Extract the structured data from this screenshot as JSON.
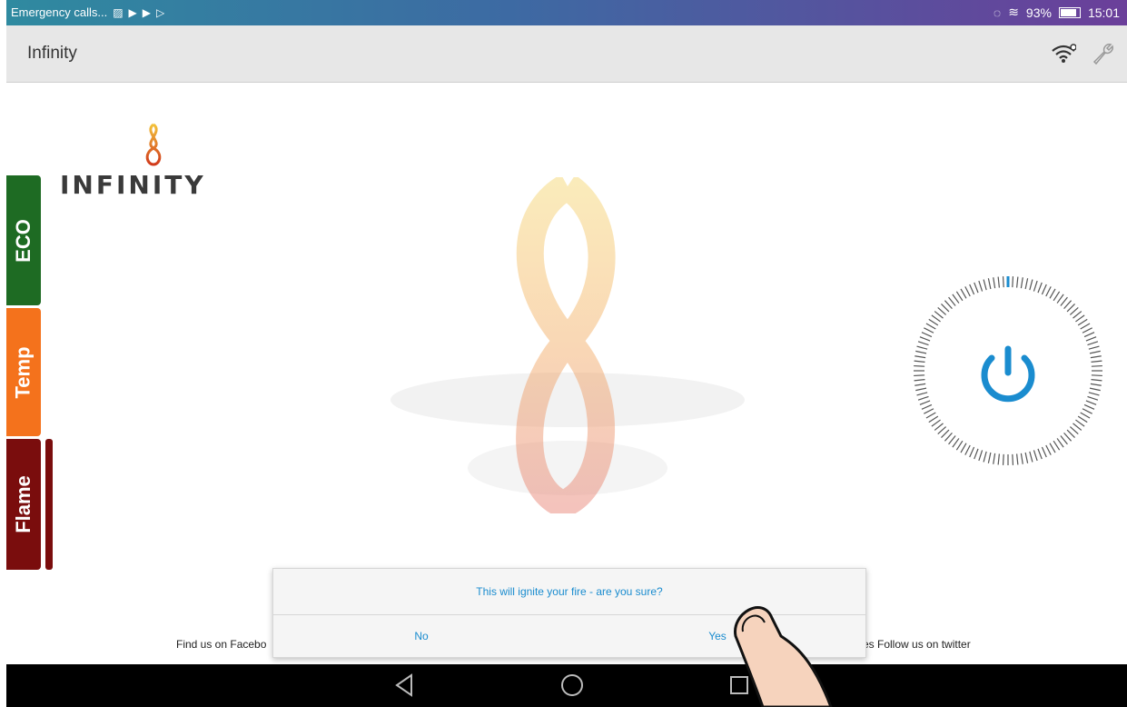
{
  "status_bar": {
    "left_text": "Emergency calls...",
    "notif_icons": [
      "image-icon",
      "play-icon",
      "play-icon",
      "play-icon"
    ],
    "battery_percent": "93%",
    "time": "15:01"
  },
  "app_bar": {
    "title": "Infinity",
    "icons": [
      "wifi-icon",
      "wrench-icon"
    ]
  },
  "brand": {
    "logo_text": "INFINITY"
  },
  "side_tabs": [
    {
      "label": "ECO",
      "color": "#1e6b23"
    },
    {
      "label": "Temp",
      "color": "#f4721c"
    },
    {
      "label": "Flame",
      "color": "#7a0d0d"
    }
  ],
  "power_dial": {
    "icon": "power-icon",
    "accent_color": "#1a8ccf"
  },
  "footer": {
    "left_text": "Find us on Facebo",
    "right_text": "es Follow us on twitter"
  },
  "dialog": {
    "message": "This will ignite your fire - are you sure?",
    "no_label": "No",
    "yes_label": "Yes"
  },
  "nav_bar": {
    "buttons": [
      "back-icon",
      "home-icon",
      "recents-icon"
    ]
  }
}
